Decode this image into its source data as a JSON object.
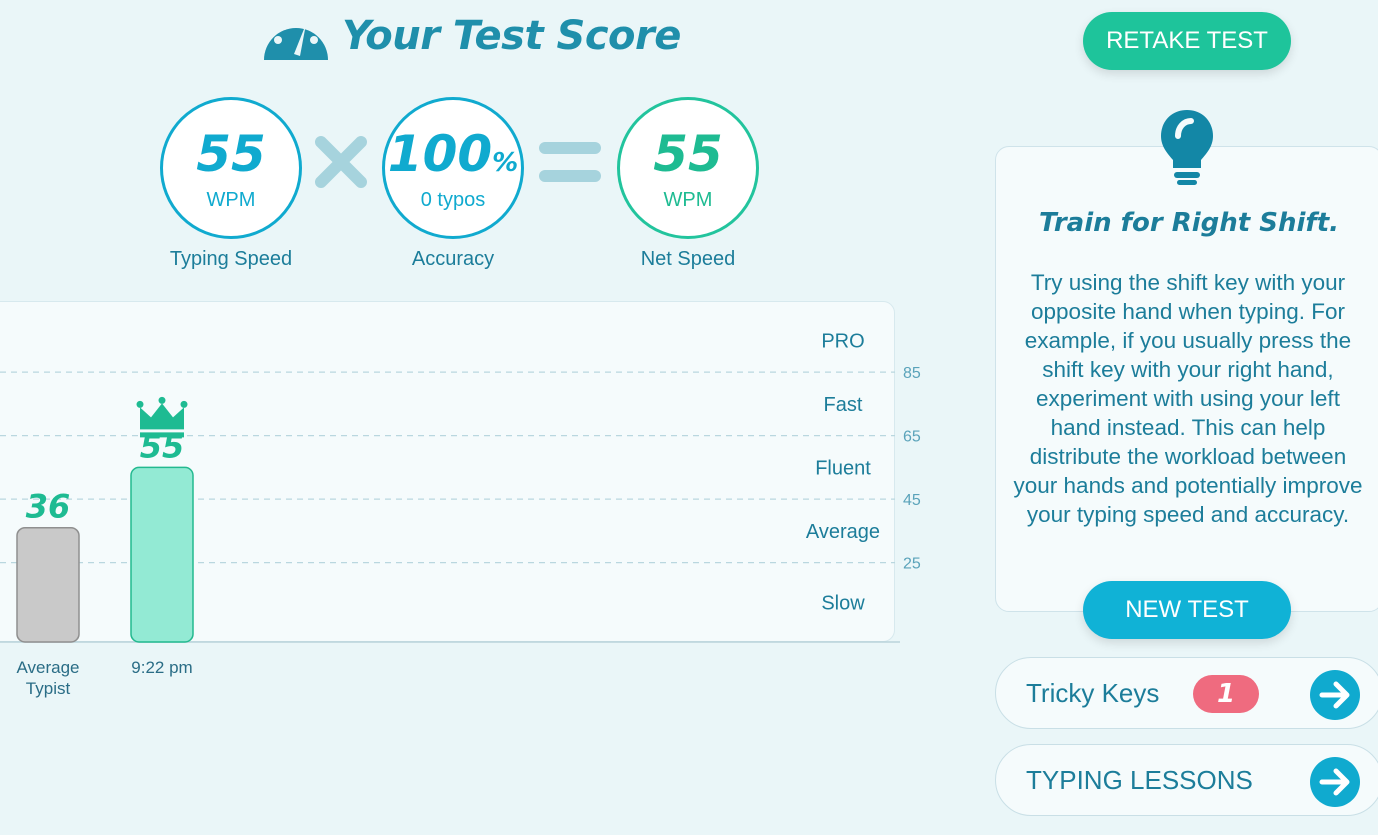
{
  "header": {
    "title": "Your Test Score",
    "icon": "speedometer-icon"
  },
  "score": {
    "typing_speed": {
      "value": "55",
      "unit": "WPM",
      "caption": "Typing Speed"
    },
    "accuracy": {
      "value": "100",
      "percent_sign": "%",
      "sub": "0 typos",
      "caption": "Accuracy"
    },
    "net_speed": {
      "value": "55",
      "unit": "WPM",
      "caption": "Net Speed"
    },
    "operator_times": "multiply-icon",
    "operator_equals": "equals-icon"
  },
  "buttons": {
    "retake": "RETAKE TEST",
    "new_test": "NEW TEST"
  },
  "tip": {
    "icon": "lightbulb-icon",
    "title": "Train for Right Shift.",
    "body": "Try using the shift key with your opposite hand when typing. For example, if you usually press the shift key with your right hand, experiment with using your left hand instead. This can help distribute the workload between your hands and potentially improve your typing speed and accuracy."
  },
  "links": {
    "tricky_keys": {
      "label": "Tricky Keys",
      "count": "1"
    },
    "typing_lessons": {
      "label": "TYPING LESSONS"
    }
  },
  "colors": {
    "accent_blue": "#10aacf",
    "accent_green": "#1ec49b",
    "badge_red": "#ef6b7f",
    "bar_gray": "#c9c9c9",
    "bar_green": "#93ead4"
  },
  "chart_data": {
    "type": "bar",
    "categories": [
      "Average\nTypist",
      "9:22 pm"
    ],
    "values": [
      36,
      55
    ],
    "value_labels": [
      "36",
      "55"
    ],
    "highlight_index": 1,
    "highlight_icon": "crown-icon",
    "ylim": [
      0,
      105
    ],
    "ticks": [
      25,
      45,
      65,
      85
    ],
    "bands": [
      "Slow",
      "Average",
      "Fluent",
      "Fast",
      "PRO"
    ],
    "grid": true
  }
}
